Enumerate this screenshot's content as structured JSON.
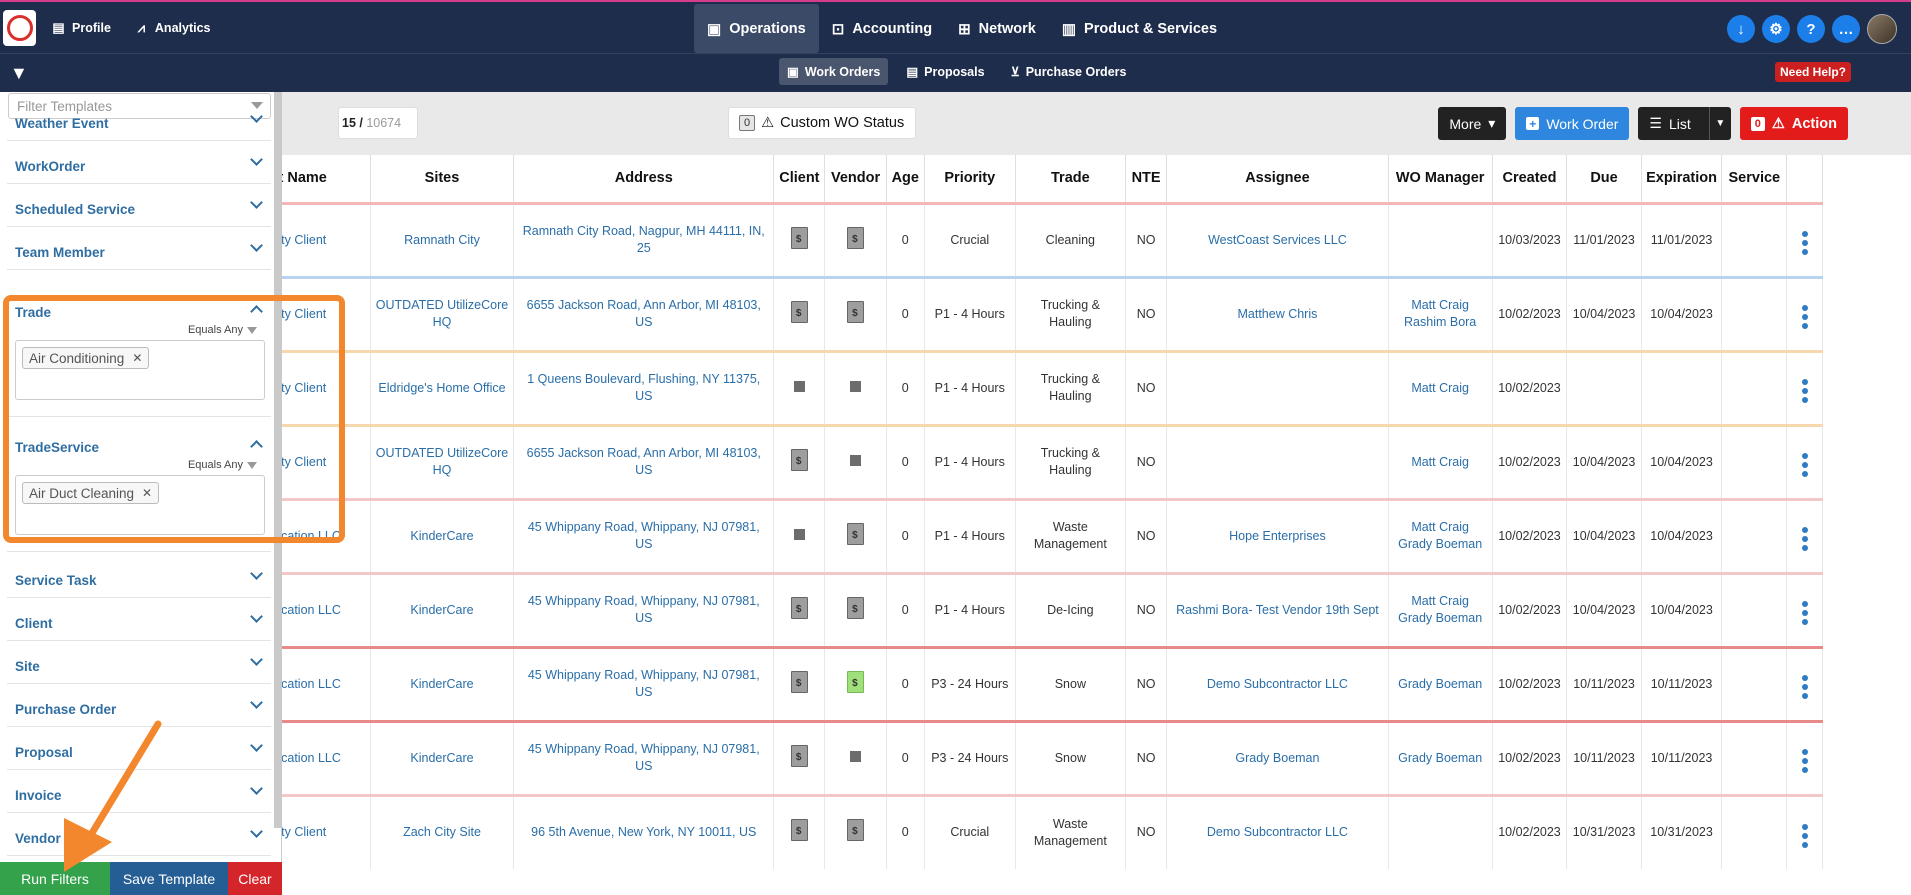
{
  "topnav": {
    "left": [
      {
        "label": "Profile",
        "icon": "document-icon"
      },
      {
        "label": "Analytics",
        "icon": "chart-icon"
      }
    ],
    "center": [
      {
        "label": "Operations",
        "icon": "clipboard-icon",
        "active": true
      },
      {
        "label": "Accounting",
        "icon": "money-icon"
      },
      {
        "label": "Network",
        "icon": "network-icon"
      },
      {
        "label": "Product & Services",
        "icon": "briefcase-icon"
      }
    ],
    "right_icons": [
      "download-icon",
      "gear-icon",
      "question-icon",
      "chat-icon"
    ]
  },
  "subnav": {
    "items": [
      {
        "label": "Work Orders",
        "active": true
      },
      {
        "label": "Proposals"
      },
      {
        "label": "Purchase Orders"
      }
    ],
    "help": "Need Help?"
  },
  "sidebar": {
    "template_placeholder": "Filter Templates",
    "sections_top": [
      "Weather Event",
      "WorkOrder",
      "Scheduled Service",
      "Team Member"
    ],
    "trade": {
      "label": "Trade",
      "operator": "Equals Any",
      "tag": "Air Conditioning"
    },
    "trade_service": {
      "label": "TradeService",
      "operator": "Equals Any",
      "tag": "Air Duct Cleaning"
    },
    "sections_bottom": [
      "Service Task",
      "Client",
      "Site",
      "Purchase Order",
      "Proposal",
      "Invoice",
      "Vendor"
    ],
    "buttons": {
      "run": "Run Filters",
      "save": "Save Template",
      "clear": "Clear"
    }
  },
  "toolbar": {
    "count_shown": "15",
    "count_sep": " / ",
    "count_total": "10674",
    "status_badge": "0",
    "status_label": "Custom WO Status",
    "more": "More",
    "work_order": "Work Order",
    "list": "List",
    "action_badge": "0",
    "action": "Action"
  },
  "table": {
    "headers": [
      "Client Name",
      "Sites",
      "Address",
      "Client",
      "Vendor",
      "Age",
      "Priority",
      "Trade",
      "NTE",
      "Assignee",
      "WO Manager",
      "Created",
      "Due",
      "Expiration",
      "Service",
      ""
    ],
    "rows": [
      {
        "client": "Property Client",
        "site": "Ramnath City",
        "address": "Ramnath City Road, Nagpur, MH 44111, IN, 25",
        "ci": "doc",
        "vi": "doc",
        "age": "0",
        "priority": "Crucial",
        "trade": "Cleaning",
        "nte": "NO",
        "assignee": "WestCoast Services LLC",
        "manager": "",
        "created": "10/03/2023",
        "due": "11/01/2023",
        "exp": "11/01/2023",
        "border": "r-red"
      },
      {
        "client": "Property Client",
        "site": "OUTDATED UtilizeCore HQ",
        "address": "6655 Jackson Road, Ann Arbor, MI 48103, US",
        "ci": "doc",
        "vi": "doc",
        "age": "0",
        "priority": "P1 - 4 Hours",
        "trade": "Trucking & Hauling",
        "nte": "NO",
        "assignee": "Matthew Chris",
        "manager": "Matt Craig Rashim Bora",
        "created": "10/02/2023",
        "due": "10/04/2023",
        "exp": "10/04/2023",
        "border": "r-blue"
      },
      {
        "client": "Property Client",
        "site": "Eldridge's Home Office",
        "address": "1 Queens Boulevard, Flushing, NY 11375, US",
        "ci": "sq",
        "vi": "sq",
        "age": "0",
        "priority": "P1 - 4 Hours",
        "trade": "Trucking & Hauling",
        "nte": "NO",
        "assignee": "",
        "manager": "Matt Craig",
        "created": "10/02/2023",
        "due": "",
        "exp": "",
        "border": "r-orange"
      },
      {
        "client": "Property Client",
        "site": "OUTDATED UtilizeCore HQ",
        "address": "6655 Jackson Road, Ann Arbor, MI 48103, US",
        "ci": "doc",
        "vi": "sq",
        "age": "0",
        "priority": "P1 - 4 Hours",
        "trade": "Trucking & Hauling",
        "nte": "NO",
        "assignee": "",
        "manager": "Matt Craig",
        "created": "10/02/2023",
        "due": "10/04/2023",
        "exp": "10/04/2023",
        "border": "r-orange"
      },
      {
        "client": "Little Education LLC",
        "site": "KinderCare",
        "address": "45 Whippany Road, Whippany, NJ 07981, US",
        "ci": "sq",
        "vi": "doc",
        "age": "0",
        "priority": "P1 - 4 Hours",
        "trade": "Waste Management",
        "nte": "NO",
        "assignee": "Hope Enterprises",
        "manager": "Matt Craig Grady Boeman",
        "created": "10/02/2023",
        "due": "10/04/2023",
        "exp": "10/04/2023",
        "border": "r-rose"
      },
      {
        "client": "Little Education LLC",
        "site": "KinderCare",
        "address": "45 Whippany Road, Whippany, NJ 07981, US",
        "ci": "doc",
        "vi": "doc",
        "age": "0",
        "priority": "P1 - 4 Hours",
        "trade": "De-Icing",
        "nte": "NO",
        "assignee": "Rashmi Bora- Test Vendor 19th Sept",
        "manager": "Matt Craig Grady Boeman",
        "created": "10/02/2023",
        "due": "10/04/2023",
        "exp": "10/04/2023",
        "border": "r-rose"
      },
      {
        "client": "Little Education LLC",
        "site": "KinderCare",
        "address": "45 Whippany Road, Whippany, NJ 07981, US",
        "ci": "doc",
        "vi": "green",
        "age": "0",
        "priority": "P3 - 24 Hours",
        "trade": "Snow",
        "nte": "NO",
        "assignee": "Demo Subcontractor LLC",
        "manager": "Grady Boeman",
        "created": "10/02/2023",
        "due": "10/11/2023",
        "exp": "10/11/2023",
        "border": "r-hred"
      },
      {
        "client": "Little Education LLC",
        "site": "KinderCare",
        "address": "45 Whippany Road, Whippany, NJ 07981, US",
        "ci": "doc",
        "vi": "sq",
        "age": "0",
        "priority": "P3 - 24 Hours",
        "trade": "Snow",
        "nte": "NO",
        "assignee": "Grady Boeman",
        "manager": "Grady Boeman",
        "created": "10/02/2023",
        "due": "10/11/2023",
        "exp": "10/11/2023",
        "border": "r-hred"
      },
      {
        "client": "Property Client",
        "site": "Zach City Site",
        "address": "96 5th Avenue, New York, NY 10011, US",
        "ci": "doc",
        "vi": "doc",
        "age": "0",
        "priority": "Crucial",
        "trade": "Waste Management",
        "nte": "NO",
        "assignee": "Demo Subcontractor LLC",
        "manager": "",
        "created": "10/02/2023",
        "due": "10/31/2023",
        "exp": "10/31/2023",
        "border": "r-rose"
      }
    ]
  },
  "colors": {
    "nav_bg": "#1e2d4b",
    "link": "#2a6ea8",
    "highlight": "#f2872e",
    "run_btn": "#33a24a",
    "save_btn": "#255e95",
    "clear_btn": "#d4252b"
  }
}
